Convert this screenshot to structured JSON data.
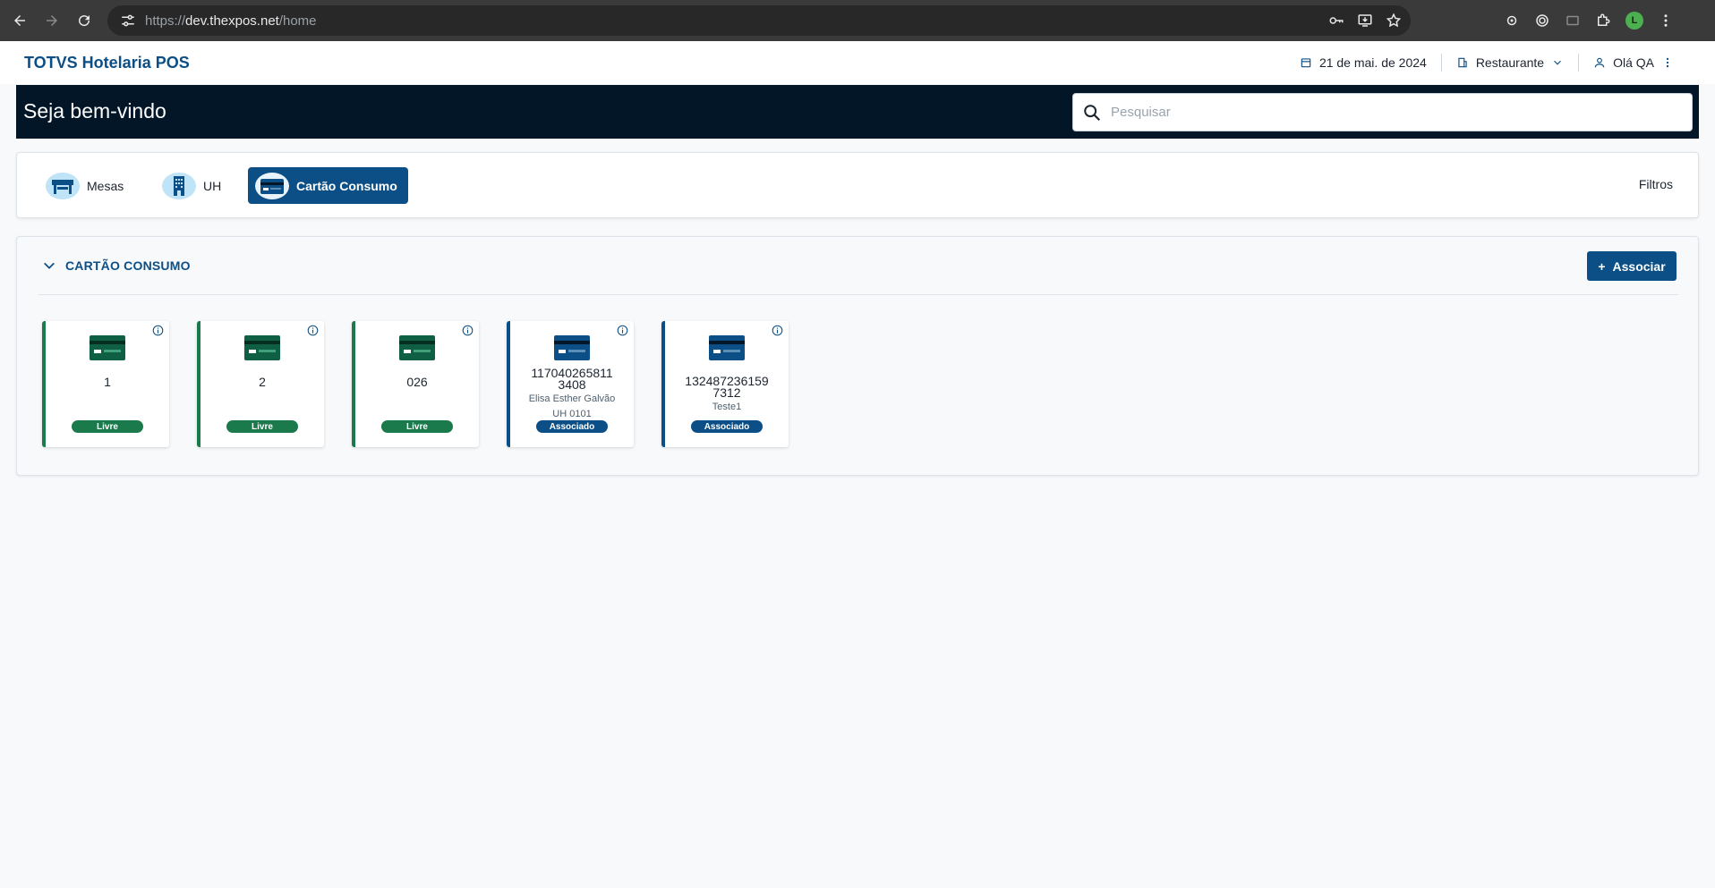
{
  "browser": {
    "url_proto": "https://",
    "url_host": "dev.thexpos.net",
    "url_path": "/home",
    "profile_initial": "L"
  },
  "header": {
    "app_title": "TOTVS Hotelaria POS",
    "date": "21 de mai. de 2024",
    "outlet": "Restaurante",
    "greeting": "Olá QA"
  },
  "banner": {
    "title": "Seja bem-vindo",
    "search_placeholder": "Pesquisar"
  },
  "tabs": {
    "items": [
      {
        "label": "Mesas",
        "icon": "table-icon",
        "active": false
      },
      {
        "label": "UH",
        "icon": "building-icon",
        "active": false
      },
      {
        "label": "Cartão Consumo",
        "icon": "card-icon",
        "active": true
      }
    ],
    "filters_label": "Filtros"
  },
  "section": {
    "title": "CARTÃO CONSUMO",
    "associar_label": "Associar",
    "cards": [
      {
        "number": "1",
        "status": "Livre",
        "lines": []
      },
      {
        "number": "2",
        "status": "Livre",
        "lines": []
      },
      {
        "number": "026",
        "status": "Livre",
        "lines": []
      },
      {
        "number_line1": "117040265811",
        "number_line2": "3408",
        "status": "Associado",
        "lines": [
          "Elisa Esther Galvão",
          "UH 0101"
        ]
      },
      {
        "number_line1": "132487236159",
        "number_line2": "7312",
        "status": "Associado",
        "lines": [
          "Teste1"
        ]
      }
    ]
  },
  "colors": {
    "brand": "#0c4f86",
    "banner_bg": "#021627",
    "livre": "#1a7a4c",
    "associado": "#0c4f86"
  }
}
